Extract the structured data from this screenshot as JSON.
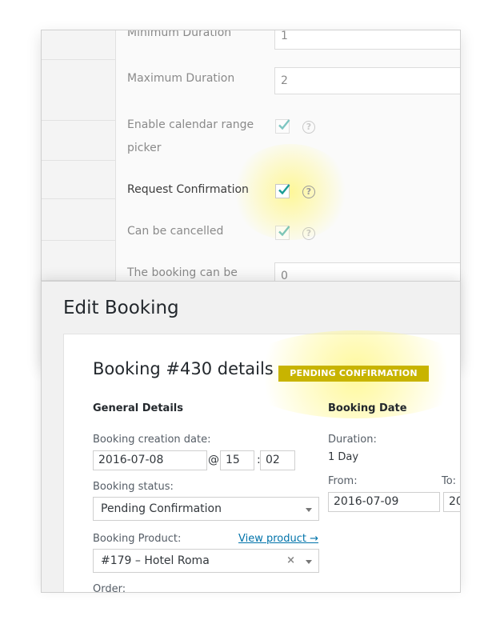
{
  "settings": {
    "rows": [
      {
        "label": "Minimum Duration",
        "value": "1"
      },
      {
        "label": "Maximum Duration",
        "value": "2"
      },
      {
        "label": "Enable calendar range",
        "label2": "picker"
      },
      {
        "label": "Request Confirmation"
      },
      {
        "label": "Can be cancelled"
      },
      {
        "label": "The booking can be",
        "value": "0"
      }
    ]
  },
  "edit": {
    "title": "Edit Booking",
    "heading": "Booking #430 details",
    "status_badge": "PENDING CONFIRMATION",
    "general": {
      "heading": "General Details",
      "creation_label": "Booking creation date:",
      "date": "2016-07-08",
      "at": "@",
      "hour": "15",
      "colon": ":",
      "minute": "02",
      "status_label": "Booking status:",
      "status_value": "Pending Confirmation",
      "product_label": "Booking Product:",
      "view_product": "View product →",
      "product_value": "#179 – Hotel Roma",
      "clear": "×",
      "order_label": "Order:"
    },
    "date": {
      "heading": "Booking Date",
      "duration_label": "Duration:",
      "duration_value": "1 Day",
      "from_label": "From:",
      "from_value": "2016-07-09",
      "to_label": "To:",
      "to_value": "20"
    }
  },
  "colors": {
    "badge": "#c8b400",
    "checkmark": "#1a9c95",
    "link": "#0073aa"
  }
}
